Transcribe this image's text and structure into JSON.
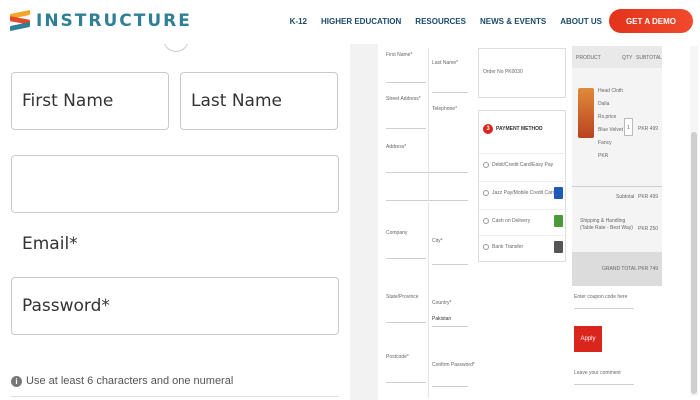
{
  "header": {
    "brand": "INSTRUCTURE",
    "nav": [
      "K-12",
      "HIGHER EDUCATION",
      "RESOURCES",
      "NEWS & EVENTS",
      "ABOUT US"
    ],
    "cta_label": "GET A DEMO",
    "colors": {
      "brand_text": "#2f7f96",
      "cta": "#e2331b",
      "nav_text": "#1b4a6b"
    }
  },
  "form": {
    "first_name_placeholder": "First Name",
    "last_name_placeholder": "Last Name",
    "blank_value": "",
    "email_label": "Email*",
    "password_placeholder": "Password*",
    "password_hint": "Use at least 6 characters and one numeral",
    "hint_icon": "info-icon"
  },
  "checkout": {
    "left_labels": [
      "First Name*",
      "Last Name*",
      "Street Address*",
      "Telephone*",
      "Address*",
      "Company",
      "City*",
      "State/Province",
      "Country*",
      "Postcode*",
      "Confirm Password*"
    ],
    "country_value": "Pakistan",
    "order_box_text": "Order No PK0030",
    "payment_title": "PAYMENT METHOD",
    "payment_step": "3",
    "payment_options": [
      "Debit/Credit Card/Easy Pay",
      "Jazz Pay/Mobile Credit Card",
      "Cash on Delivery",
      "Bank Transfer"
    ],
    "summary_headers": [
      "PRODUCT",
      "QTY",
      "SUBTOTAL"
    ],
    "product_lines": [
      "Head Cloth",
      "Dalia",
      "Rs.price",
      "Blue Velvet",
      "Fancy",
      "PKR"
    ],
    "product_price": "PKR 499",
    "qty": "1",
    "subtotal_label": "Subtotal",
    "subtotal_value": "PKR 499",
    "shipping_label": "Shipping & Handling (Table Rate - Best Way)",
    "shipping_value": "PKR 250",
    "grand_total_label": "GRAND TOTAL",
    "grand_total_value": "PKR 749",
    "coupon_label": "Enter coupon code here",
    "apply_label": "Apply",
    "comment_label": "Leave your comment"
  }
}
